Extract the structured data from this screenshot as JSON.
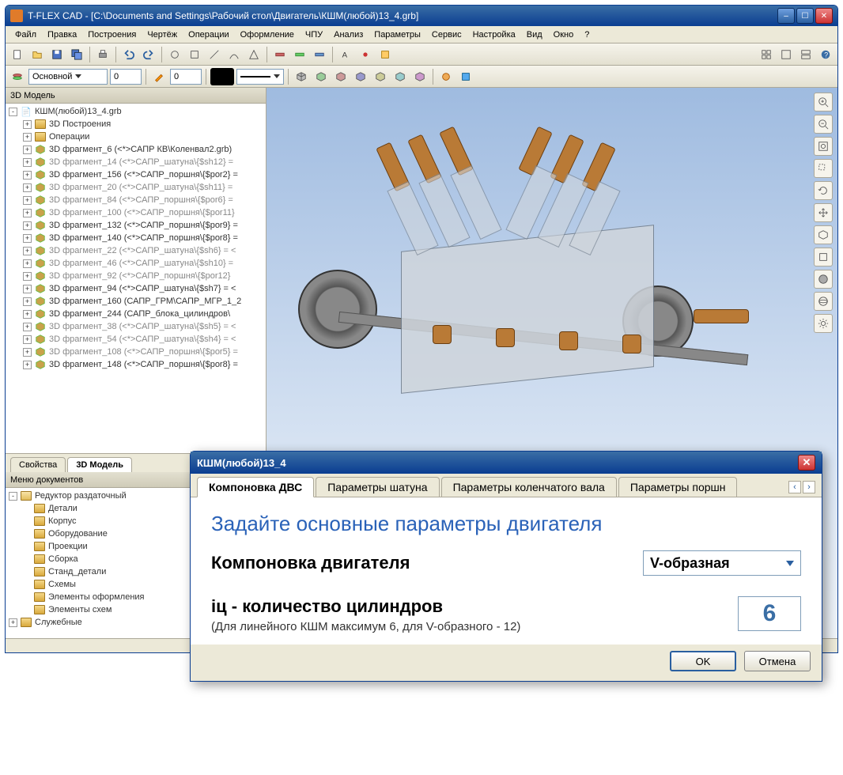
{
  "app": {
    "title": "T-FLEX CAD - [C:\\Documents and Settings\\Рабочий стол\\Двигатель\\КШМ(любой)13_4.grb]"
  },
  "menu": {
    "items": [
      "Файл",
      "Правка",
      "Построения",
      "Чертёж",
      "Операции",
      "Оформление",
      "ЧПУ",
      "Анализ",
      "Параметры",
      "Сервис",
      "Настройка",
      "Вид",
      "Окно",
      "?"
    ]
  },
  "toolbar2": {
    "layer_combo": "Основной",
    "spin1": "0",
    "spin2": "0"
  },
  "left": {
    "panel_title": "3D Модель",
    "tabs": [
      "Свойства",
      "3D Модель"
    ],
    "active_tab": 1,
    "root": "КШМ(любой)13_4.grb",
    "items": [
      {
        "t": "3D Построения",
        "lvl": 1,
        "dim": false,
        "folder": true
      },
      {
        "t": "Операции",
        "lvl": 1,
        "dim": false,
        "folder": true
      },
      {
        "t": "3D фрагмент_6 (<*>САПР КВ\\Коленвал2.grb)",
        "lvl": 1,
        "dim": false
      },
      {
        "t": "3D фрагмент_14 (<*>САПР_шатуна\\{$sh12} =",
        "lvl": 1,
        "dim": true
      },
      {
        "t": "3D фрагмент_156 (<*>САПР_поршня\\{$por2} =",
        "lvl": 1,
        "dim": false
      },
      {
        "t": "3D фрагмент_20 (<*>САПР_шатуна\\{$sh11} =",
        "lvl": 1,
        "dim": true
      },
      {
        "t": "3D фрагмент_84 (<*>САПР_поршня\\{$por6} =",
        "lvl": 1,
        "dim": true
      },
      {
        "t": "3D фрагмент_100 (<*>САПР_поршня\\{$por11}",
        "lvl": 1,
        "dim": true
      },
      {
        "t": "3D фрагмент_132 (<*>САПР_поршня\\{$por9} =",
        "lvl": 1,
        "dim": false
      },
      {
        "t": "3D фрагмент_140 (<*>САПР_поршня\\{$por8} =",
        "lvl": 1,
        "dim": false
      },
      {
        "t": "3D фрагмент_22 (<*>САПР_шатуна\\{$sh6} = <",
        "lvl": 1,
        "dim": true
      },
      {
        "t": "3D фрагмент_46 (<*>САПР_шатуна\\{$sh10} =",
        "lvl": 1,
        "dim": true
      },
      {
        "t": "3D фрагмент_92 (<*>САПР_поршня\\{$por12}",
        "lvl": 1,
        "dim": true
      },
      {
        "t": "3D фрагмент_94 (<*>САПР_шатуна\\{$sh7} = <",
        "lvl": 1,
        "dim": false
      },
      {
        "t": "3D фрагмент_160 (САПР_ГРМ\\САПР_МГР_1_2",
        "lvl": 1,
        "dim": false
      },
      {
        "t": "3D фрагмент_244 (САПР_блока_цилиндров\\",
        "lvl": 1,
        "dim": false
      },
      {
        "t": "3D фрагмент_38 (<*>САПР_шатуна\\{$sh5} = <",
        "lvl": 1,
        "dim": true
      },
      {
        "t": "3D фрагмент_54 (<*>САПР_шатуна\\{$sh4} = <",
        "lvl": 1,
        "dim": true
      },
      {
        "t": "3D фрагмент_108 (<*>САПР_поршня\\{$por5} =",
        "lvl": 1,
        "dim": true
      },
      {
        "t": "3D фрагмент_148 (<*>САПР_поршня\\{$por8} =",
        "lvl": 1,
        "dim": false
      }
    ],
    "doc_menu_title": "Меню документов",
    "doc_root": "Редуктор раздаточный",
    "doc_items": [
      "Детали",
      "Корпус",
      "Оборудование",
      "Проекции",
      "Сборка",
      "Станд_детали",
      "Схемы",
      "Элементы оформления",
      "Элементы схем"
    ],
    "doc_root2": "Служебные"
  },
  "dialog": {
    "title": "КШМ(любой)13_4",
    "tabs": [
      "Компоновка ДВС",
      "Параметры шатуна",
      "Параметры коленчатого вала",
      "Параметры поршн"
    ],
    "active_tab": 0,
    "heading": "Задайте основные параметры двигателя",
    "layout_label": "Компоновка двигателя",
    "layout_value": "V-образная",
    "cyl_label": "iц  - количество цилиндров",
    "cyl_note": "(Для линейного КШМ максимум 6, для V-образного - 12)",
    "cyl_value": "6",
    "ok": "OK",
    "cancel": "Отмена"
  }
}
